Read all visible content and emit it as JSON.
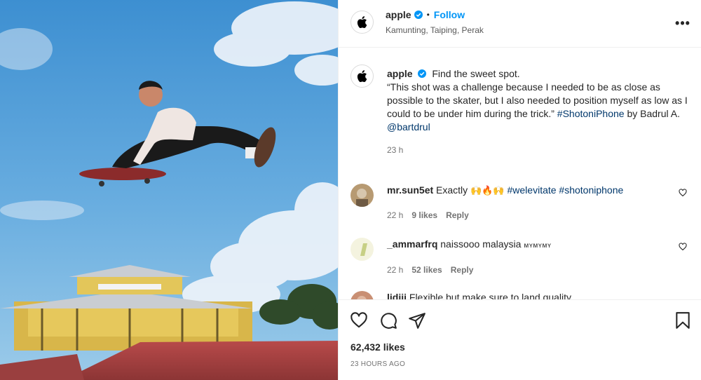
{
  "post": {
    "username": "apple",
    "follow_label": "Follow",
    "location": "Kamunting, Taiping, Perak",
    "more_label": "•••"
  },
  "caption": {
    "username": "apple",
    "text": "Find the sweet spot.",
    "quote": "“This shot was a challenge because I needed to be as close as possible to the skater, but I also needed to position myself as low as I could to be under him during the trick.”",
    "hashtag": "#ShotoniPhone",
    "by": "by",
    "credit_name": "Badrul A.",
    "credit_handle": "@bartdrul",
    "time": "23 h"
  },
  "comments": [
    {
      "username": "mr.sun5et",
      "text": "Exactly",
      "emoji": "🙌🔥🙌",
      "hashtags": "#welevitate #shotoniphone",
      "time": "22 h",
      "likes": "9 likes",
      "reply": "Reply"
    },
    {
      "username": "_ammarfrq",
      "text": "naissooo malaysia",
      "suffix": "ᴍʏᴍʏᴍʏ",
      "time": "22 h",
      "likes": "52 likes",
      "reply": "Reply"
    },
    {
      "username": "lidiii",
      "text": "Flexible but make sure to land quality"
    }
  ],
  "actions": {
    "likes": "62,432 likes",
    "time": "23 HOURS AGO"
  },
  "colors": {
    "accent": "#0095f6",
    "link": "#00376b",
    "verified": "#0095f6",
    "secondary_text": "#737373"
  },
  "icons": {
    "logo": "apple-logo-icon",
    "verified": "verified-badge-icon",
    "more": "more-options-icon",
    "like": "heart-icon",
    "comment": "comment-icon",
    "share": "share-icon",
    "save": "bookmark-icon"
  }
}
